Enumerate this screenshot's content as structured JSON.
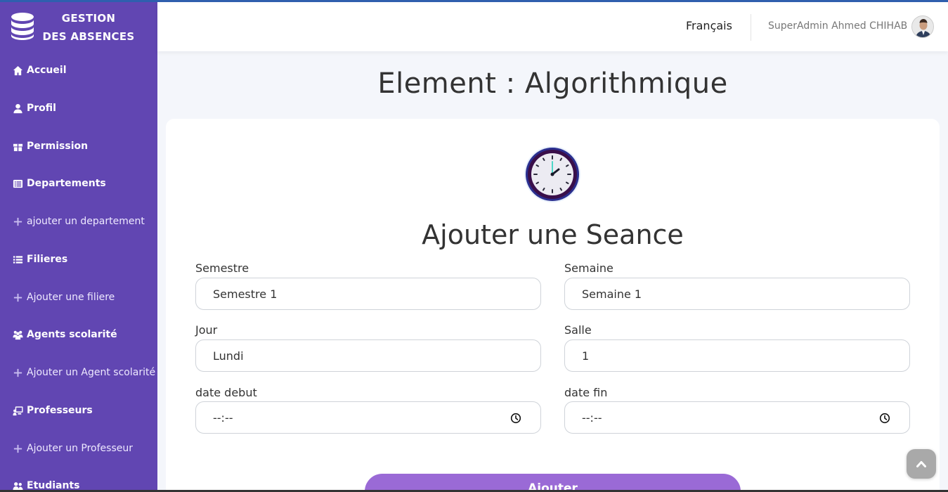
{
  "brand": {
    "line1": "GESTION",
    "line2": "DES ABSENCES",
    "icon": "database-icon"
  },
  "sidebar": {
    "items": [
      {
        "label": "Accueil",
        "icon": "home-icon"
      },
      {
        "label": "Profil",
        "icon": "user-icon"
      },
      {
        "label": "Permission",
        "icon": "gift-icon"
      },
      {
        "label": "Departements",
        "icon": "list-alt-icon"
      },
      {
        "label": "ajouter un departement",
        "icon": "plus-icon"
      },
      {
        "label": "Filieres",
        "icon": "list-icon"
      },
      {
        "label": "Ajouter une filiere",
        "icon": "plus-icon"
      },
      {
        "label": "Agents scolarité",
        "icon": "people-icon"
      },
      {
        "label": "Ajouter un Agent scolarité",
        "icon": "plus-icon"
      },
      {
        "label": "Professeurs",
        "icon": "chalkboard-icon"
      },
      {
        "label": "Ajouter un Professeur",
        "icon": "plus-icon"
      },
      {
        "label": "Etudiants",
        "icon": "users-icon"
      }
    ]
  },
  "header": {
    "language": "Français",
    "user": "SuperAdmin Ahmed CHIHAB"
  },
  "page": {
    "title": "Element : Algorithmique"
  },
  "form": {
    "title": "Ajouter une Seance",
    "fields": {
      "semestre": {
        "label": "Semestre",
        "value": "Semestre 1"
      },
      "semaine": {
        "label": "Semaine",
        "value": "Semaine 1"
      },
      "jour": {
        "label": "Jour",
        "value": "Lundi"
      },
      "salle": {
        "label": "Salle",
        "value": "1"
      },
      "date_debut": {
        "label": "date debut",
        "value": "--:--"
      },
      "date_fin": {
        "label": "date fin",
        "value": "--:--"
      }
    },
    "submit": "Ajouter"
  },
  "colors": {
    "sidebar": "#6146b2",
    "button": "#9a6ad6",
    "topstrip": "#2f5fae"
  }
}
